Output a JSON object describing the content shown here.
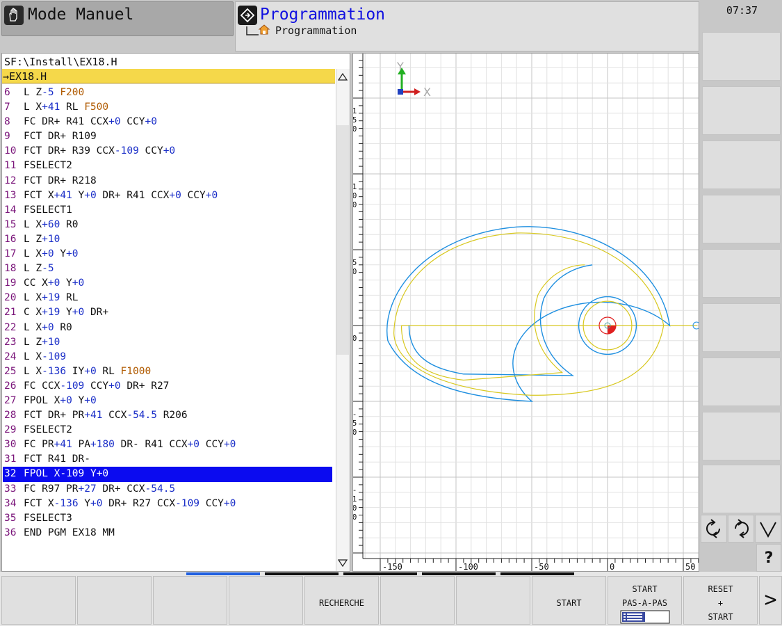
{
  "header": {
    "mode_label": "Mode Manuel",
    "program_title": "Programmation",
    "program_breadcrumb": "Programmation",
    "clock": "07:37"
  },
  "file": {
    "path": "SF:\\Install\\EX18.H",
    "name": "→EX18.H"
  },
  "program_lines": [
    {
      "n": "6",
      "tokens": [
        [
          "L",
          ""
        ],
        [
          "Z",
          "-5"
        ],
        [
          "F200",
          "f"
        ]
      ]
    },
    {
      "n": "7",
      "tokens": [
        [
          "L",
          ""
        ],
        [
          "X",
          "+41"
        ],
        [
          "RL",
          ""
        ],
        [
          "F500",
          "f"
        ]
      ]
    },
    {
      "n": "8",
      "tokens": [
        [
          "FC",
          ""
        ],
        [
          "DR+",
          ""
        ],
        [
          "R41",
          ""
        ],
        [
          "CCX",
          "+0"
        ],
        [
          "CCY",
          "+0"
        ]
      ]
    },
    {
      "n": "9",
      "tokens": [
        [
          "FCT",
          ""
        ],
        [
          "DR+",
          ""
        ],
        [
          "R109",
          ""
        ]
      ]
    },
    {
      "n": "10",
      "tokens": [
        [
          "FCT",
          ""
        ],
        [
          "DR+",
          ""
        ],
        [
          "R39",
          ""
        ],
        [
          "CCX",
          "-109"
        ],
        [
          "CCY",
          "+0"
        ]
      ]
    },
    {
      "n": "11",
      "tokens": [
        [
          "FSELECT2",
          ""
        ]
      ]
    },
    {
      "n": "12",
      "tokens": [
        [
          "FCT",
          ""
        ],
        [
          "DR+",
          ""
        ],
        [
          "R218",
          ""
        ]
      ]
    },
    {
      "n": "13",
      "tokens": [
        [
          "FCT",
          ""
        ],
        [
          "X",
          "+41"
        ],
        [
          "Y",
          "+0"
        ],
        [
          "DR+",
          ""
        ],
        [
          "R41",
          ""
        ],
        [
          "CCX",
          "+0"
        ],
        [
          "CCY",
          "+0"
        ]
      ]
    },
    {
      "n": "14",
      "tokens": [
        [
          "FSELECT1",
          ""
        ]
      ]
    },
    {
      "n": "15",
      "tokens": [
        [
          "L",
          ""
        ],
        [
          "X",
          "+60"
        ],
        [
          "R0",
          ""
        ]
      ]
    },
    {
      "n": "16",
      "tokens": [
        [
          "L",
          ""
        ],
        [
          "Z",
          "+10"
        ]
      ]
    },
    {
      "n": "17",
      "tokens": [
        [
          "L",
          ""
        ],
        [
          "X",
          "+0"
        ],
        [
          "Y",
          "+0"
        ]
      ]
    },
    {
      "n": "18",
      "tokens": [
        [
          "L",
          ""
        ],
        [
          "Z",
          "-5"
        ]
      ]
    },
    {
      "n": "19",
      "tokens": [
        [
          "CC",
          ""
        ],
        [
          "X",
          "+0"
        ],
        [
          "Y",
          "+0"
        ]
      ]
    },
    {
      "n": "20",
      "tokens": [
        [
          "L",
          ""
        ],
        [
          "X",
          "+19"
        ],
        [
          "RL",
          ""
        ]
      ]
    },
    {
      "n": "21",
      "tokens": [
        [
          "C",
          ""
        ],
        [
          "X",
          "+19"
        ],
        [
          "Y",
          "+0"
        ],
        [
          "DR+",
          ""
        ]
      ]
    },
    {
      "n": "22",
      "tokens": [
        [
          "L",
          ""
        ],
        [
          "X",
          "+0"
        ],
        [
          "R0",
          ""
        ]
      ]
    },
    {
      "n": "23",
      "tokens": [
        [
          "L",
          ""
        ],
        [
          "Z",
          "+10"
        ]
      ]
    },
    {
      "n": "24",
      "tokens": [
        [
          "L",
          ""
        ],
        [
          "X",
          "-109"
        ]
      ]
    },
    {
      "n": "25",
      "tokens": [
        [
          "L",
          ""
        ],
        [
          "X",
          "-136"
        ],
        [
          "IY",
          "+0"
        ],
        [
          "RL",
          ""
        ],
        [
          "F1000",
          "f"
        ]
      ]
    },
    {
      "n": "26",
      "tokens": [
        [
          "FC",
          ""
        ],
        [
          "CCX",
          "-109"
        ],
        [
          "CCY",
          "+0"
        ],
        [
          "DR+",
          ""
        ],
        [
          "R27",
          ""
        ]
      ]
    },
    {
      "n": "27",
      "tokens": [
        [
          "FPOL",
          ""
        ],
        [
          "X",
          "+0"
        ],
        [
          "Y",
          "+0"
        ]
      ]
    },
    {
      "n": "28",
      "tokens": [
        [
          "FCT",
          ""
        ],
        [
          "DR+",
          ""
        ],
        [
          "PR",
          "+41"
        ],
        [
          "CCX",
          "-54.5"
        ],
        [
          "R206",
          ""
        ]
      ]
    },
    {
      "n": "29",
      "tokens": [
        [
          "FSELECT2",
          ""
        ]
      ]
    },
    {
      "n": "30",
      "tokens": [
        [
          "FC",
          ""
        ],
        [
          "PR",
          "+41"
        ],
        [
          "PA",
          "+180"
        ],
        [
          "DR-",
          ""
        ],
        [
          "R41",
          ""
        ],
        [
          "CCX",
          "+0"
        ],
        [
          "CCY",
          "+0"
        ]
      ]
    },
    {
      "n": "31",
      "tokens": [
        [
          "FCT",
          ""
        ],
        [
          "R41",
          ""
        ],
        [
          "DR-",
          ""
        ]
      ]
    },
    {
      "n": "32",
      "tokens": [
        [
          "FPOL",
          ""
        ],
        [
          "X",
          "-109"
        ],
        [
          "Y",
          "+0"
        ]
      ],
      "selected": true
    },
    {
      "n": "33",
      "tokens": [
        [
          "FC",
          ""
        ],
        [
          "R97",
          ""
        ],
        [
          "PR",
          "+27"
        ],
        [
          "DR+",
          ""
        ],
        [
          "CCX",
          "-54.5"
        ]
      ]
    },
    {
      "n": "34",
      "tokens": [
        [
          "FCT",
          ""
        ],
        [
          "X",
          "-136"
        ],
        [
          "Y",
          "+0"
        ],
        [
          "DR+",
          ""
        ],
        [
          "R27",
          ""
        ],
        [
          "CCX",
          "-109"
        ],
        [
          "CCY",
          "+0"
        ]
      ]
    },
    {
      "n": "35",
      "tokens": [
        [
          "FSELECT3",
          ""
        ]
      ]
    },
    {
      "n": "36",
      "tokens": [
        [
          "END",
          ""
        ],
        [
          "PGM",
          ""
        ],
        [
          "EX18",
          ""
        ],
        [
          "MM",
          ""
        ]
      ]
    }
  ],
  "graphic": {
    "axis_x_label": "X",
    "axis_y_label": "Y",
    "x_ticks": [
      "-150",
      "-100",
      "-50",
      "0",
      "50"
    ],
    "y_ticks": [
      "150",
      "100",
      "50",
      "0",
      "-50",
      "-100"
    ],
    "colors": {
      "contour": "#1e8fe0",
      "path": "#d8c820",
      "grid": "#d8d8d8",
      "origin": "#e02020"
    }
  },
  "softkeys": {
    "recherche": "RECHERCHE",
    "start": "START",
    "start_pas_a_pas": [
      "START",
      "PAS-A-PAS"
    ],
    "reset_start": [
      "RESET",
      "+",
      "START"
    ],
    "next": ">"
  },
  "right_keys": {
    "help": "?"
  }
}
